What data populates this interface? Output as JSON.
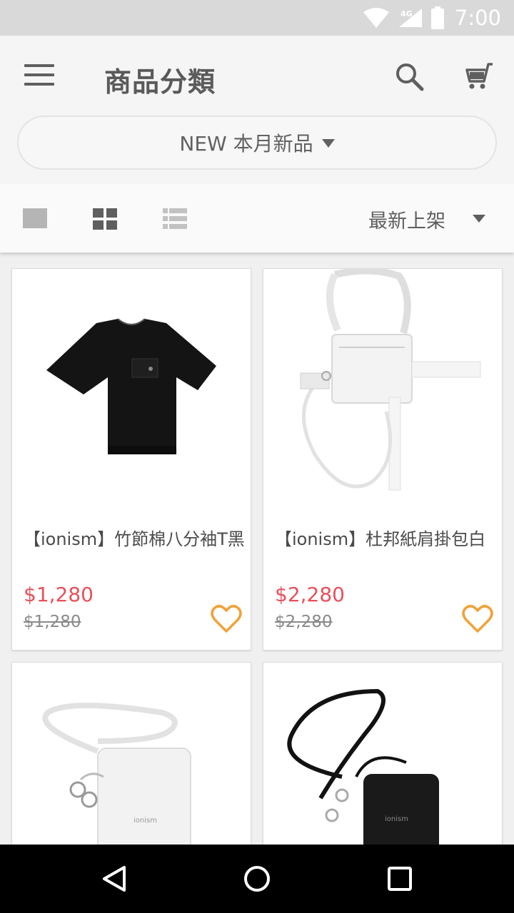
{
  "status_bar": {
    "network": "4G",
    "time": "7:00"
  },
  "app_bar": {
    "title": "商品分類"
  },
  "category": {
    "label": "NEW 本月新品"
  },
  "toolbar": {
    "sort_label": "最新上架"
  },
  "products": [
    {
      "name": "【ionism】竹節棉八分袖T黑",
      "price": "$1,280",
      "original_price": "$1,280",
      "image": "black-tshirt"
    },
    {
      "name": "【ionism】杜邦紙肩掛包白",
      "price": "$2,280",
      "original_price": "$2,280",
      "image": "white-shoulder-bag"
    },
    {
      "name": "",
      "price": "",
      "original_price": "",
      "image": "white-pouch"
    },
    {
      "name": "",
      "price": "",
      "original_price": "",
      "image": "black-pouch"
    }
  ],
  "colors": {
    "price": "#e8505b",
    "favorite": "#f0a23a",
    "title": "#5a5a5a"
  }
}
